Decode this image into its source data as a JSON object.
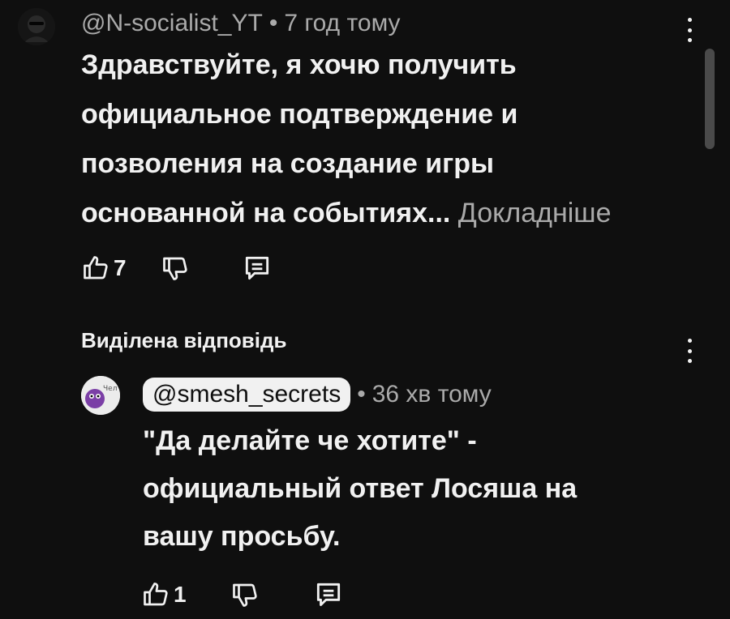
{
  "comment": {
    "author": "@N-socialist_YT",
    "separator": "•",
    "time": "7 год тому",
    "text_lines": [
      "Здравствуйте, я хочю получить",
      "официальное подтверждение и",
      "позволения на создание игры",
      "основанной на событиях..."
    ],
    "read_more": "Докладніше",
    "likes": "7"
  },
  "highlighted_label": "Виділена відповідь",
  "reply": {
    "author": "@smesh_secrets",
    "separator": "•",
    "time": "36 хв тому",
    "avatar_text": "Чел",
    "text_lines": [
      "\"Да делайте че хотите\" -",
      "официальный ответ Лосяша на",
      "вашу просьбу."
    ],
    "likes": "1"
  },
  "colors": {
    "background": "#0f0f0f",
    "text_primary": "#f1f1f1",
    "text_secondary": "#aaaaaa",
    "chip_bg": "#f1f1f1"
  },
  "icons": [
    "like-icon",
    "dislike-icon",
    "reply-icon",
    "more-vert-icon"
  ]
}
